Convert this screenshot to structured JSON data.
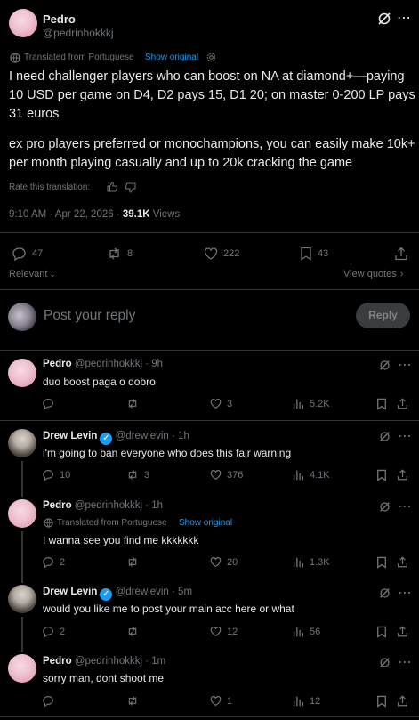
{
  "main_tweet": {
    "name": "Pedro",
    "handle": "@pedrinhokkkj",
    "translated_label": "Translated from Portuguese",
    "show_original": "Show original",
    "text_p1": "I need challenger players who can boost on NA at diamond+—paying 10 USD per game on D4, D2 pays 15, D1 20; on master 0-200 LP pays 31 euros",
    "text_p2": "ex pro players preferred or monochampions, you can easily make 10k+ per month playing casually and up to 20k cracking the game",
    "rate_label": "Rate this translation:",
    "time": "9:10 AM · Apr 22, 2026 · ",
    "views_count": "39.1K",
    "views_label": " Views",
    "replies": "47",
    "reposts": "8",
    "likes": "222",
    "bookmarks": "43",
    "relevant_label": "Relevant",
    "view_quotes": "View quotes"
  },
  "reply_box": {
    "placeholder": "Post your reply",
    "button": "Reply"
  },
  "replies": [
    {
      "name": "Pedro",
      "handle": "@pedrinhokkkj",
      "time": "· 9h",
      "text": "duo boost paga o dobro",
      "replies": "",
      "reposts": "",
      "likes": "3",
      "views": "5.2K"
    },
    {
      "name": "Drew Levin",
      "handle": "@drewlevin",
      "time": "· 1h",
      "text": "i'm going to ban everyone who does this fair warning",
      "replies": "10",
      "reposts": "3",
      "likes": "376",
      "views": "4.1K"
    },
    {
      "name": "Pedro",
      "handle": "@pedrinhokkkj",
      "time": "· 1h",
      "translated_label": "Translated from Portuguese",
      "show_original": "Show original",
      "text": "I wanna see you find me kkkkkkk",
      "replies": "2",
      "reposts": "",
      "likes": "20",
      "views": "1.3K"
    },
    {
      "name": "Drew Levin",
      "handle": "@drewlevin",
      "time": "· 5m",
      "text": "would you like me to post your main acc here or what",
      "replies": "2",
      "reposts": "",
      "likes": "12",
      "views": "56"
    },
    {
      "name": "Pedro",
      "handle": "@pedrinhokkkj",
      "time": "· 1m",
      "text": "sorry man, dont shoot me",
      "replies": "",
      "reposts": "",
      "likes": "1",
      "views": "12"
    }
  ]
}
